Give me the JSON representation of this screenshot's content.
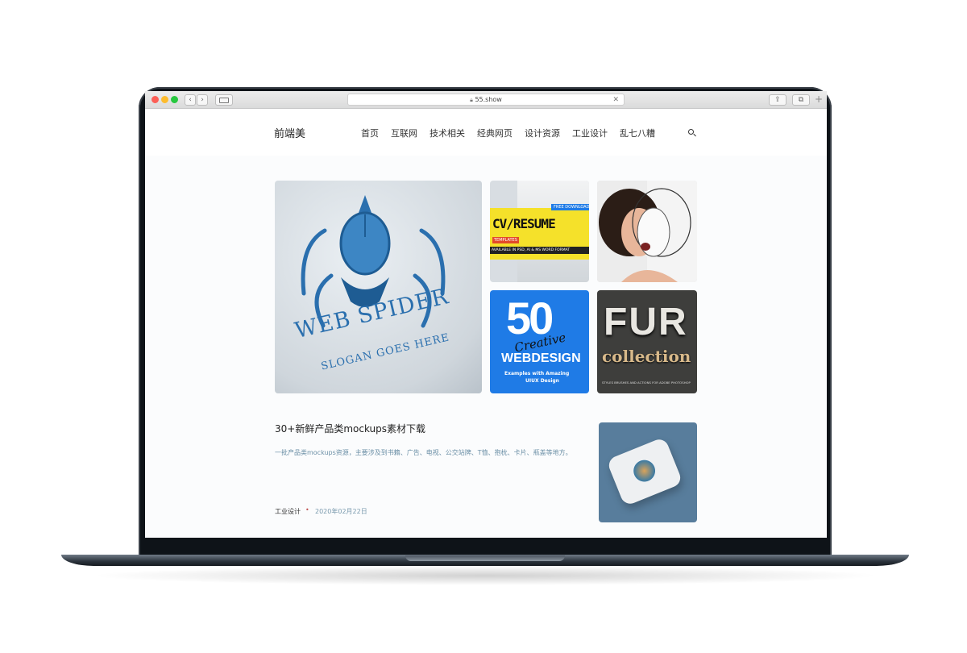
{
  "browser": {
    "url": "55.show",
    "back_glyph": "‹",
    "forward_glyph": "›",
    "close_glyph": "✕",
    "share_glyph": "⇪",
    "tabs_glyph": "⧉",
    "plus_glyph": "+"
  },
  "site": {
    "logo": "前端美",
    "nav": [
      "首页",
      "互联网",
      "技术相关",
      "经典网页",
      "设计资源",
      "工业设计",
      "乱七八糟"
    ],
    "search_icon": "search-icon"
  },
  "featured": {
    "main": {
      "line1": "WEB SPIDER",
      "line2": "SLOGAN GOES HERE"
    },
    "cv": {
      "badge": "FREE DOWNLOAD",
      "title": "CV/RESUME",
      "sub": "TEMPLATES",
      "footer": "AVAILABLE IN PSD, AI & MS WORD FORMAT"
    },
    "webdesign": {
      "number": "50",
      "script": "Creative",
      "title": "WEBDESIGN",
      "sub1": "Examples with Amazing",
      "sub2": "UIUX Design"
    },
    "fur": {
      "title": "FUR",
      "sub": "collection",
      "footer": "STYLES BRUSHES AND ACTIONS FOR ADOBE PHOTOSHOP"
    }
  },
  "post": {
    "title": "30+新鲜产品类mockups素材下载",
    "excerpt": "一批产品类mockups资源，主要涉及到书籍、广告、电视、公交站牌、T恤、抱枕、卡片、瓶盖等地方。",
    "category": "工业设计",
    "separator": "•",
    "date": "2020年02月22日"
  },
  "colors": {
    "accent": "#1f7be6",
    "cv_yellow": "#f5e12a",
    "spider_blue": "#2a6fae"
  }
}
